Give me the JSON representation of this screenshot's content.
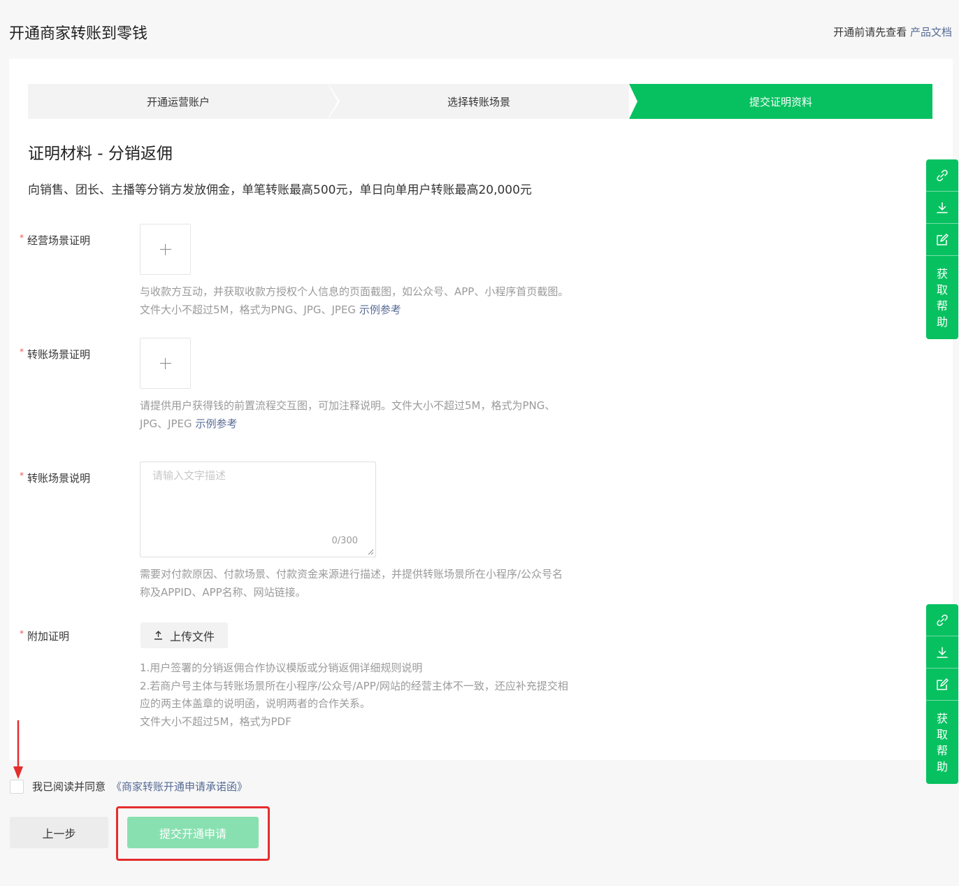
{
  "page": {
    "title": "开通商家转账到零钱",
    "doc_hint": "开通前请先查看",
    "doc_link": "产品文档"
  },
  "steps": [
    {
      "label": "开通运营账户",
      "active": false
    },
    {
      "label": "选择转账场景",
      "active": false
    },
    {
      "label": "提交证明资料",
      "active": true
    }
  ],
  "section": {
    "title": "证明材料 - 分销返佣",
    "description": "向销售、团长、主播等分销方发放佣金，单笔转账最高500元，单日向单用户转账最高20,000元"
  },
  "fields": {
    "business_proof": {
      "label": "经营场景证明",
      "hint": "与收款方互动，并获取收款方授权个人信息的页面截图，如公众号、APP、小程序首页截图。文件大小不超过5M，格式为PNG、JPG、JPEG",
      "example_link": "示例参考"
    },
    "transfer_proof": {
      "label": "转账场景证明",
      "hint": "请提供用户获得钱的前置流程交互图，可加注释说明。文件大小不超过5M，格式为PNG、JPG、JPEG",
      "example_link": "示例参考"
    },
    "transfer_desc": {
      "label": "转账场景说明",
      "placeholder": "请输入文字描述",
      "counter": "0/300",
      "hint": "需要对付款原因、付款场景、付款资金来源进行描述，并提供转账场景所在小程序/公众号名称及APPID、APP名称、网站链接。"
    },
    "extra_proof": {
      "label": "附加证明",
      "button": "上传文件",
      "hint_lines": [
        "1.用户签署的分销返佣合作协议模版或分销返佣详细规则说明",
        "2.若商户号主体与转账场景所在小程序/公众号/APP/网站的经营主体不一致，还应补充提交相应的两主体盖章的说明函，说明两者的合作关系。",
        "文件大小不超过5M，格式为PDF"
      ]
    }
  },
  "agreement": {
    "text": "我已阅读并同意",
    "link": "《商家转账开通申请承诺函》"
  },
  "actions": {
    "prev": "上一步",
    "submit": "提交开通申请"
  },
  "float_bar": {
    "icons": [
      "link-icon",
      "download-icon",
      "edit-icon"
    ],
    "help_chars": [
      "获",
      "取",
      "帮",
      "助"
    ]
  },
  "colors": {
    "brand_green": "#07c160",
    "disabled_green": "#88e0b0",
    "link_blue": "#576b95",
    "required_red": "#fa5151",
    "annotation_red": "#e52d2d"
  }
}
